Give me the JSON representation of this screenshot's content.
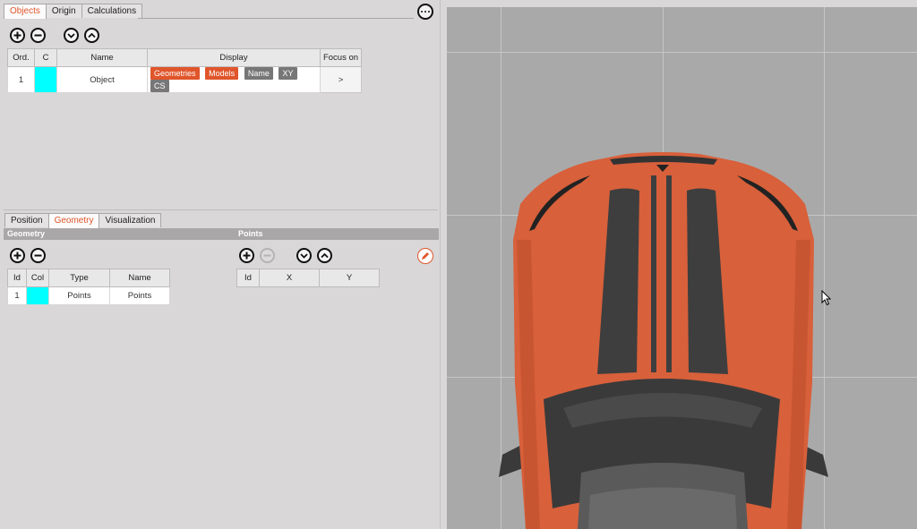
{
  "top_tabs": [
    "Objects",
    "Origin",
    "Calculations"
  ],
  "top_active_tab": 0,
  "objects_table": {
    "headers": [
      "Ord.",
      "C",
      "Name",
      "Display",
      "Focus on"
    ],
    "rows": [
      {
        "ord": "1",
        "color": "#00ffff",
        "name": "Object",
        "display": [
          {
            "label": "Geometries",
            "active": true
          },
          {
            "label": "Models",
            "active": true
          },
          {
            "label": "Name",
            "active": false
          },
          {
            "label": "XY",
            "active": false
          },
          {
            "label": "CS",
            "active": false
          }
        ],
        "focus": ">"
      }
    ]
  },
  "bottom_tabs": [
    "Position",
    "Geometry",
    "Visualization"
  ],
  "bottom_active_tab": 1,
  "geometry_section": {
    "title": "Geometry",
    "headers": [
      "Id",
      "Col",
      "Type",
      "Name"
    ],
    "rows": [
      {
        "id": "1",
        "color": "#00ffff",
        "type": "Points",
        "name": "Points"
      }
    ]
  },
  "points_section": {
    "title": "Points",
    "headers": [
      "Id",
      "X",
      "Y"
    ]
  },
  "colors": {
    "accent": "#e0552b",
    "viewport_bg": "#a9a9a9",
    "car_body": "#d8603b",
    "stripe": "#3c3c3c"
  },
  "icons": [
    "add-icon",
    "remove-icon",
    "move-down-icon",
    "move-up-icon",
    "more-options-icon",
    "edit-pencil-icon",
    "mouse-cursor-icon"
  ]
}
